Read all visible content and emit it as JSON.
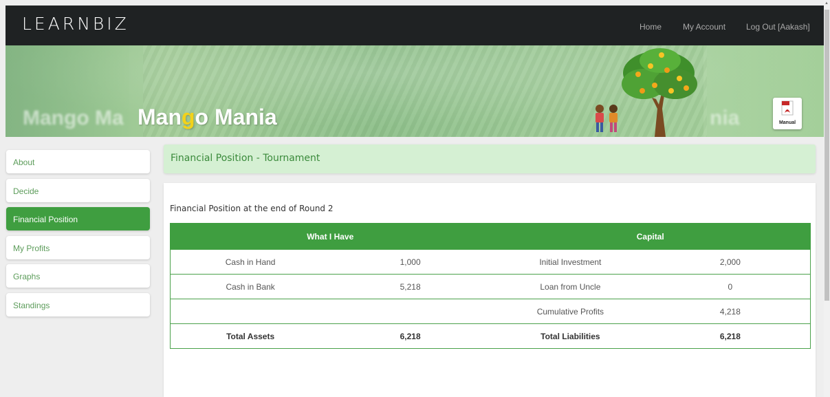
{
  "app": {
    "logo": "LEARNBIZ"
  },
  "nav": {
    "home": "Home",
    "account": "My Account",
    "logout": "Log Out [Aakash]"
  },
  "banner": {
    "title_prefix": "Man",
    "title_glyph": "g",
    "title_suffix": "o Mania",
    "ghost_left": "Mango Ma",
    "ghost_right": "nia",
    "manual_label": "Manual"
  },
  "sidebar": {
    "items": [
      {
        "label": "About"
      },
      {
        "label": "Decide"
      },
      {
        "label": "Financial Position",
        "active": true
      },
      {
        "label": "My Profits"
      },
      {
        "label": "Graphs"
      },
      {
        "label": "Standings"
      }
    ]
  },
  "main": {
    "header": "Financial Position - Tournament",
    "section_title": "Financial Position at the end of Round 2",
    "table": {
      "headers": [
        "What I Have",
        "Capital"
      ],
      "rows": [
        [
          "Cash in Hand",
          "1,000",
          "Initial Investment",
          "2,000"
        ],
        [
          "Cash in Bank",
          "5,218",
          "Loan from Uncle",
          "0"
        ],
        [
          "",
          "",
          "Cumulative Profits",
          "4,218"
        ],
        [
          "Total Assets",
          "6,218",
          "Total Liabilities",
          "6,218"
        ]
      ]
    }
  },
  "colors": {
    "accent": "#3f9e40",
    "header_bg": "#d5f0d3",
    "navbar": "#1f2223",
    "mango_yellow": "#f2d21b"
  }
}
